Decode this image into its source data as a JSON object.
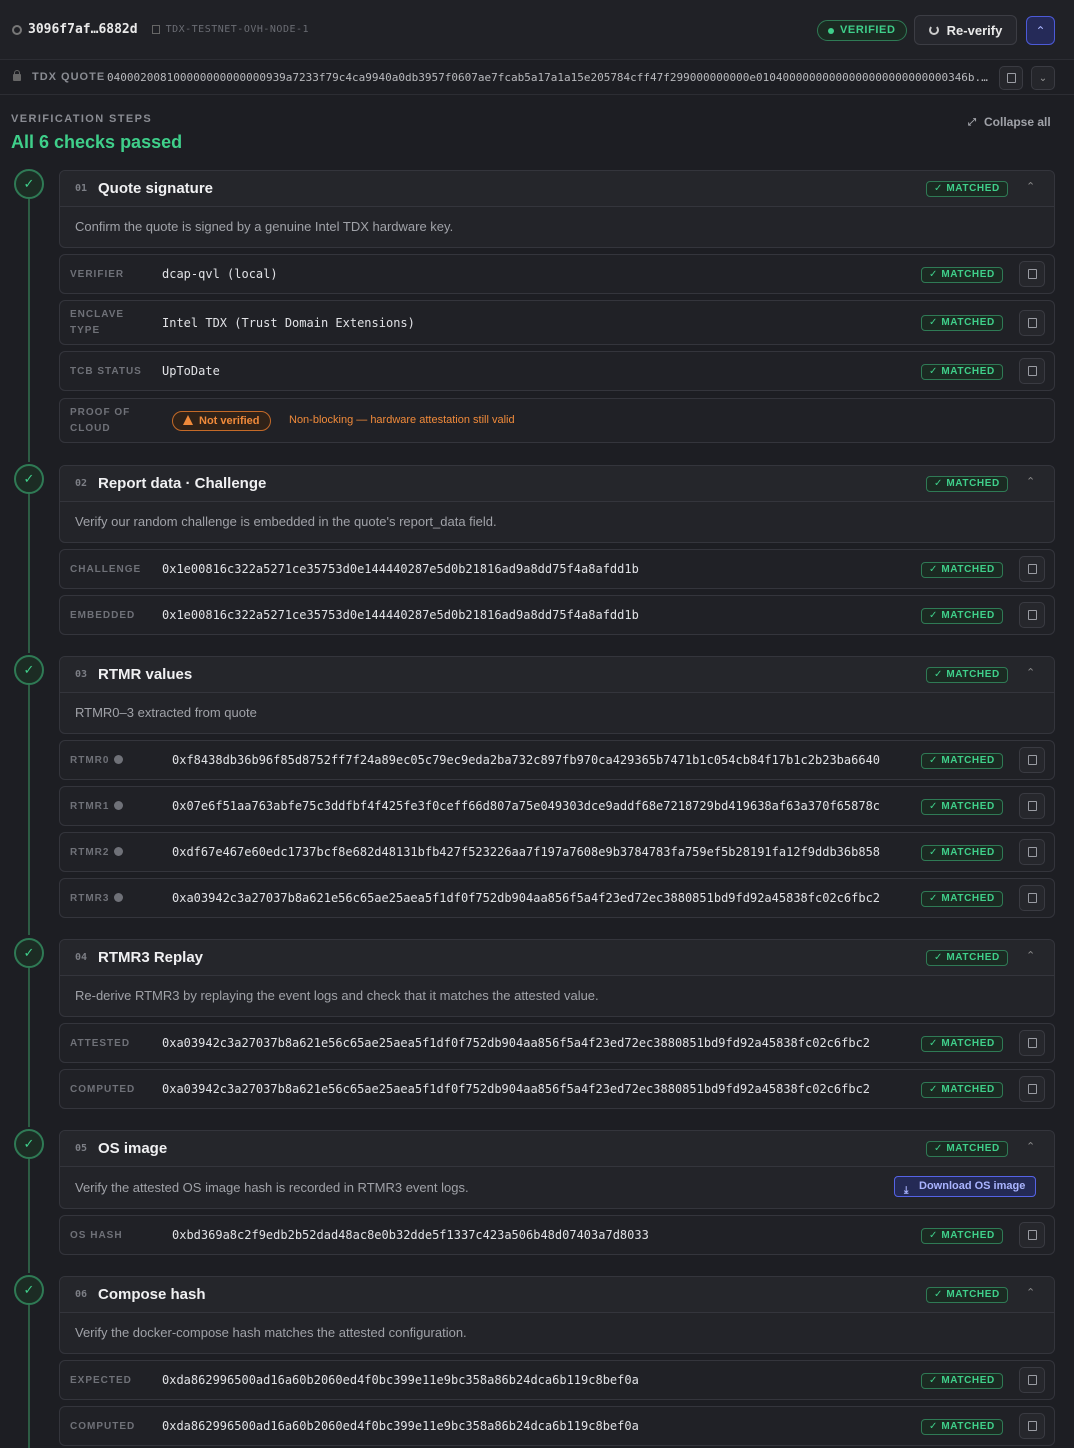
{
  "header": {
    "node_id": "3096f7af…6882d",
    "node_name": "TDX-TESTNET-OVH-NODE-1",
    "status_badge": "VERIFIED",
    "reverify_label": "Re-verify"
  },
  "quote": {
    "label": "TDX QUOTE",
    "value": "040002008100000000000000939a7233f79c4ca9940a0db3957f0607ae7fcab5a17a1a15e205784cff47f299000000000e01040000000000000000000000000346b..."
  },
  "steps_header": {
    "title": "VERIFICATION STEPS",
    "summary": "All 6 checks passed",
    "collapse_all": "Collapse all"
  },
  "matched_label": "✓ MATCHED",
  "steps": [
    {
      "num": "01",
      "title": "Quote signature",
      "desc": "Confirm the quote is signed by a genuine Intel TDX hardware key.",
      "rows": [
        {
          "label": "VERIFIER",
          "value": "dcap-qvl (local)"
        },
        {
          "label": "ENCLAVE TYPE",
          "value": "Intel TDX (Trust Domain Extensions)"
        },
        {
          "label": "TCB STATUS",
          "value": "UpToDate"
        }
      ],
      "proof": {
        "label": "PROOF OF CLOUD",
        "pill": "Not verified",
        "note": "Non-blocking — hardware attestation still valid"
      }
    },
    {
      "num": "02",
      "title": "Report data · Challenge",
      "desc": "Verify our random challenge is embedded in the quote's report_data field.",
      "rows": [
        {
          "label": "CHALLENGE",
          "value": "0x1e00816c322a5271ce35753d0e144440287e5d0b21816ad9a8dd75f4a8afdd1b"
        },
        {
          "label": "EMBEDDED",
          "value": "0x1e00816c322a5271ce35753d0e144440287e5d0b21816ad9a8dd75f4a8afdd1b"
        }
      ]
    },
    {
      "num": "03",
      "title": "RTMR values",
      "desc": "RTMR0–3 extracted from quote",
      "rows": [
        {
          "label": "RTMR0",
          "value": "0xf8438db36b96f85d8752ff7f24a89ec05c79ec9eda2ba732c897fb970ca429365b7471b1c054cb84f17b1c2b23ba6640"
        },
        {
          "label": "RTMR1",
          "value": "0x07e6f51aa763abfe75c3ddfbf4f425fe3f0ceff66d807a75e049303dce9addf68e7218729bd419638af63a370f65878c"
        },
        {
          "label": "RTMR2",
          "value": "0xdf67e467e60edc1737bcf8e682d48131bfb427f523226aa7f197a7608e9b3784783fa759ef5b28191fa12f9ddb36b858"
        },
        {
          "label": "RTMR3",
          "value": "0xa03942c3a27037b8a621e56c65ae25aea5f1df0f752db904aa856f5a4f23ed72ec3880851bd9fd92a45838fc02c6fbc2"
        }
      ]
    },
    {
      "num": "04",
      "title": "RTMR3 Replay",
      "desc": "Re-derive RTMR3 by replaying the event logs and check that it matches the attested value.",
      "rows": [
        {
          "label": "ATTESTED",
          "value": "0xa03942c3a27037b8a621e56c65ae25aea5f1df0f752db904aa856f5a4f23ed72ec3880851bd9fd92a45838fc02c6fbc2"
        },
        {
          "label": "COMPUTED",
          "value": "0xa03942c3a27037b8a621e56c65ae25aea5f1df0f752db904aa856f5a4f23ed72ec3880851bd9fd92a45838fc02c6fbc2"
        }
      ]
    },
    {
      "num": "05",
      "title": "OS image",
      "desc": "Verify the attested OS image hash is recorded in RTMR3 event logs.",
      "download_label": "Download OS image",
      "rows": [
        {
          "label": "OS HASH",
          "value": "0xbd369a8c2f9edb2b52dad48ac8e0b32dde5f1337c423a506b48d07403a7d8033"
        }
      ]
    },
    {
      "num": "06",
      "title": "Compose hash",
      "desc": "Verify the docker-compose hash matches the attested configuration.",
      "rows": [
        {
          "label": "EXPECTED",
          "value": "0xda862996500ad16a60b2060ed4f0bc399e11e9bc358a86b24dca6b119c8bef0a"
        },
        {
          "label": "COMPUTED",
          "value": "0xda862996500ad16a60b2060ed4f0bc399e11e9bc358a86b24dca6b119c8bef0a"
        }
      ]
    }
  ]
}
